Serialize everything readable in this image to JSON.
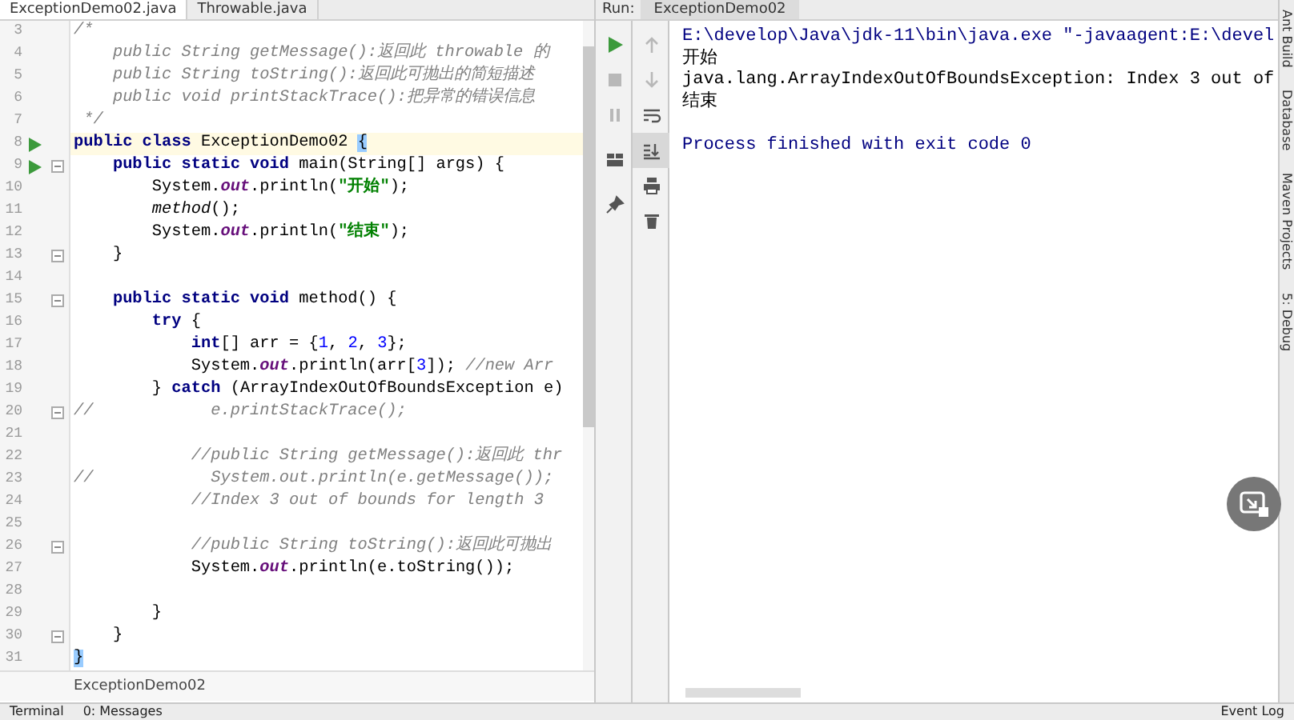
{
  "editor": {
    "tabs": [
      {
        "label": "ExceptionDemo02.java",
        "selected": true
      },
      {
        "label": "Throwable.java",
        "selected": false
      }
    ],
    "lines": [
      {
        "number": "3",
        "run": false,
        "fold": false,
        "current": false,
        "segments": [
          {
            "kind": "comment",
            "text": "/*"
          }
        ]
      },
      {
        "number": "4",
        "run": false,
        "fold": false,
        "current": false,
        "segments": [
          {
            "kind": "comment",
            "text": "    public String getMessage():返回此 throwable 的"
          }
        ]
      },
      {
        "number": "5",
        "run": false,
        "fold": false,
        "current": false,
        "segments": [
          {
            "kind": "comment",
            "text": "    public String toString():返回此可抛出的简短描述"
          }
        ]
      },
      {
        "number": "6",
        "run": false,
        "fold": false,
        "current": false,
        "segments": [
          {
            "kind": "comment",
            "text": "    public void printStackTrace():把异常的错误信息"
          }
        ]
      },
      {
        "number": "7",
        "run": false,
        "fold": false,
        "current": false,
        "segments": [
          {
            "kind": "comment",
            "text": " */"
          }
        ]
      },
      {
        "number": "8",
        "run": true,
        "fold": false,
        "current": true,
        "segments": [
          {
            "kind": "keyword",
            "text": "public class"
          },
          {
            "kind": "plain",
            "text": " ExceptionDemo02 "
          },
          {
            "kind": "match",
            "text": "{"
          }
        ]
      },
      {
        "number": "9",
        "run": true,
        "fold": true,
        "current": false,
        "segments": [
          {
            "kind": "keyword",
            "text": "    public static void"
          },
          {
            "kind": "plain",
            "text": " main(String[] args) {"
          }
        ]
      },
      {
        "number": "10",
        "run": false,
        "fold": false,
        "current": false,
        "segments": [
          {
            "kind": "plain",
            "text": "        System."
          },
          {
            "kind": "field",
            "text": "out"
          },
          {
            "kind": "plain",
            "text": ".println("
          },
          {
            "kind": "string",
            "text": "\"开始\""
          },
          {
            "kind": "plain",
            "text": ");"
          }
        ]
      },
      {
        "number": "11",
        "run": false,
        "fold": false,
        "current": false,
        "segments": [
          {
            "kind": "call",
            "text": "        method"
          },
          {
            "kind": "plain",
            "text": "();"
          }
        ]
      },
      {
        "number": "12",
        "run": false,
        "fold": false,
        "current": false,
        "segments": [
          {
            "kind": "plain",
            "text": "        System."
          },
          {
            "kind": "field",
            "text": "out"
          },
          {
            "kind": "plain",
            "text": ".println("
          },
          {
            "kind": "string",
            "text": "\"结束\""
          },
          {
            "kind": "plain",
            "text": ");"
          }
        ]
      },
      {
        "number": "13",
        "run": false,
        "fold": true,
        "current": false,
        "segments": [
          {
            "kind": "plain",
            "text": "    }"
          }
        ]
      },
      {
        "number": "14",
        "run": false,
        "fold": false,
        "current": false
      },
      {
        "number": "15",
        "run": false,
        "fold": true,
        "current": false,
        "segments": [
          {
            "kind": "keyword",
            "text": "    public static void"
          },
          {
            "kind": "plain",
            "text": " method() {"
          }
        ]
      },
      {
        "number": "16",
        "run": false,
        "fold": false,
        "current": false,
        "segments": [
          {
            "kind": "keyword",
            "text": "        try"
          },
          {
            "kind": "plain",
            "text": " {"
          }
        ]
      },
      {
        "number": "17",
        "run": false,
        "fold": false,
        "current": false,
        "segments": [
          {
            "kind": "keyword",
            "text": "            int"
          },
          {
            "kind": "plain",
            "text": "[] arr = {"
          },
          {
            "kind": "number",
            "text": "1"
          },
          {
            "kind": "plain",
            "text": ", "
          },
          {
            "kind": "number",
            "text": "2"
          },
          {
            "kind": "plain",
            "text": ", "
          },
          {
            "kind": "number",
            "text": "3"
          },
          {
            "kind": "plain",
            "text": "};"
          }
        ]
      },
      {
        "number": "18",
        "run": false,
        "fold": false,
        "current": false,
        "segments": [
          {
            "kind": "plain",
            "text": "            System."
          },
          {
            "kind": "field",
            "text": "out"
          },
          {
            "kind": "plain",
            "text": ".println(arr["
          },
          {
            "kind": "number",
            "text": "3"
          },
          {
            "kind": "plain",
            "text": "]); "
          },
          {
            "kind": "comment",
            "text": "//new Arr"
          }
        ]
      },
      {
        "number": "19",
        "run": false,
        "fold": false,
        "current": false,
        "segments": [
          {
            "kind": "plain",
            "text": "        } "
          },
          {
            "kind": "keyword",
            "text": "catch"
          },
          {
            "kind": "plain",
            "text": " (ArrayIndexOutOfBoundsException e)"
          }
        ]
      },
      {
        "number": "20",
        "run": false,
        "fold": true,
        "current": false,
        "segments": [
          {
            "kind": "comment",
            "text": "//            e.printStackTrace();"
          }
        ]
      },
      {
        "number": "21",
        "run": false,
        "fold": false,
        "current": false
      },
      {
        "number": "22",
        "run": false,
        "fold": false,
        "current": false,
        "segments": [
          {
            "kind": "comment",
            "text": "            //public String getMessage():返回此 thr"
          }
        ]
      },
      {
        "number": "23",
        "run": false,
        "fold": false,
        "current": false,
        "segments": [
          {
            "kind": "comment",
            "text": "//            System.out.println(e.getMessage());"
          }
        ]
      },
      {
        "number": "24",
        "run": false,
        "fold": false,
        "current": false,
        "segments": [
          {
            "kind": "comment",
            "text": "            //Index 3 out of bounds for length 3"
          }
        ]
      },
      {
        "number": "25",
        "run": false,
        "fold": false,
        "current": false
      },
      {
        "number": "26",
        "run": false,
        "fold": true,
        "current": false,
        "segments": [
          {
            "kind": "comment",
            "text": "            //public String toString():返回此可抛出"
          }
        ]
      },
      {
        "number": "27",
        "run": false,
        "fold": false,
        "current": false,
        "segments": [
          {
            "kind": "plain",
            "text": "            System."
          },
          {
            "kind": "field",
            "text": "out"
          },
          {
            "kind": "plain",
            "text": ".println(e.toString());"
          }
        ]
      },
      {
        "number": "28",
        "run": false,
        "fold": false,
        "current": false
      },
      {
        "number": "29",
        "run": false,
        "fold": false,
        "current": false,
        "segments": [
          {
            "kind": "plain",
            "text": "        }"
          }
        ]
      },
      {
        "number": "30",
        "run": false,
        "fold": true,
        "current": false,
        "segments": [
          {
            "kind": "plain",
            "text": "    }"
          }
        ]
      },
      {
        "number": "31",
        "run": false,
        "fold": false,
        "current": false,
        "segments": [
          {
            "kind": "match",
            "text": "}"
          }
        ]
      }
    ],
    "breadcrumb": "ExceptionDemo02"
  },
  "run": {
    "label": "Run:",
    "tabs": [
      {
        "label": "ExceptionDemo02",
        "selected": true
      }
    ],
    "run_tools": [
      {
        "kind": "run",
        "disabled": false
      },
      {
        "kind": "stop",
        "disabled": true
      },
      {
        "kind": "pause",
        "disabled": true
      },
      {
        "kind": "layout",
        "disabled": false
      },
      {
        "kind": "pin",
        "disabled": false
      }
    ],
    "console_tools": [
      {
        "kind": "up",
        "disabled": true,
        "pressed": false
      },
      {
        "kind": "down",
        "disabled": true,
        "pressed": false
      },
      {
        "kind": "wrap",
        "disabled": false,
        "pressed": false
      },
      {
        "kind": "scroll",
        "disabled": false,
        "pressed": true
      },
      {
        "kind": "print",
        "disabled": false,
        "pressed": false
      },
      {
        "kind": "trash",
        "disabled": false,
        "pressed": false
      }
    ],
    "console": [
      {
        "kind": "command",
        "text": "E:\\develop\\Java\\jdk-11\\bin\\java.exe \"-javaagent:E:\\devel"
      },
      {
        "kind": "output",
        "text": "开始"
      },
      {
        "kind": "output",
        "text": "java.lang.ArrayIndexOutOfBoundsException: Index 3 out of"
      },
      {
        "kind": "output",
        "text": "结束"
      },
      {
        "kind": "status",
        "text": "Process finished with exit code 0"
      }
    ]
  },
  "side_tools": [
    "Ant Build",
    "Database",
    "Maven Projects",
    "5: Debug"
  ],
  "bottom_bar": {
    "left": [
      "Terminal",
      "0: Messages"
    ],
    "right": [
      "Event Log"
    ]
  }
}
